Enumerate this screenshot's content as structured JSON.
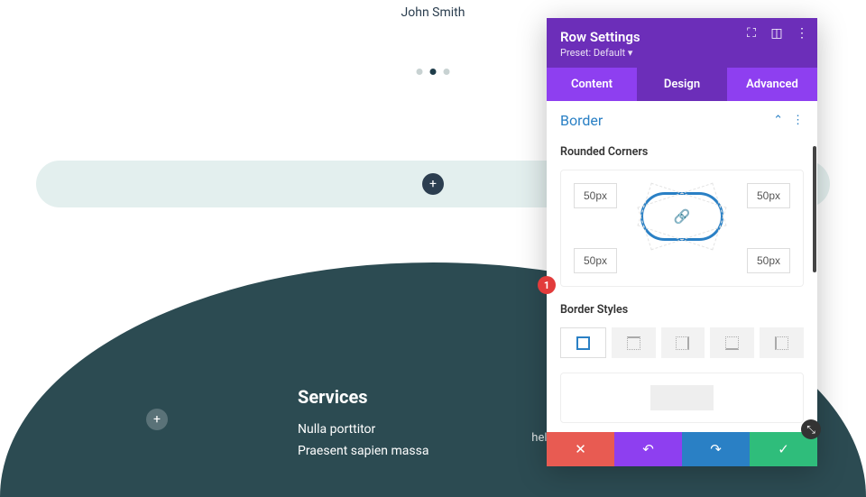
{
  "canvas": {
    "author": "John Smith",
    "services_heading": "Services",
    "services_items": [
      "Nulla porttitor",
      "Praesent sapien massa"
    ],
    "email_partial": "hello@divitherapy.com"
  },
  "panel": {
    "title": "Row Settings",
    "preset_label": "Preset: Default ▾",
    "tabs": {
      "content": "Content",
      "design": "Design",
      "advanced": "Advanced"
    },
    "section": {
      "title": "Border",
      "rounded_label": "Rounded Corners",
      "corner_tl": "50px",
      "corner_tr": "50px",
      "corner_bl": "50px",
      "corner_br": "50px",
      "styles_label": "Border Styles"
    },
    "badge": "1"
  }
}
